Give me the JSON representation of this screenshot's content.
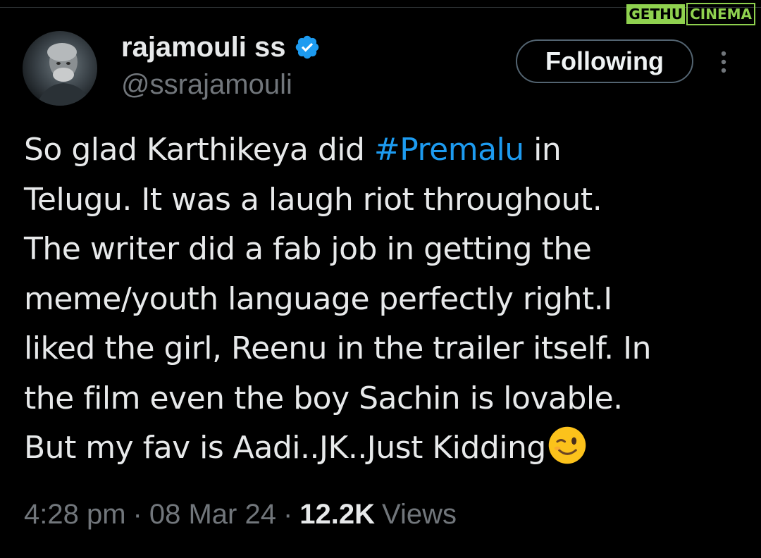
{
  "watermark": {
    "part_a": "GETHU",
    "part_b": "CINEMA"
  },
  "author": {
    "display_name": "rajamouli ss",
    "handle": "@ssrajamouli",
    "verified": true,
    "verified_color": "#1d9bf0"
  },
  "follow_button": {
    "label": "Following"
  },
  "tweet": {
    "lines": [
      {
        "before": "So glad Karthikeya did ",
        "hashtag": "#Premalu",
        "after": " in"
      },
      {
        "text": "Telugu. It was a laugh riot throughout."
      },
      {
        "text": "The writer did a fab job in getting the"
      },
      {
        "text": "meme/youth language perfectly right.I"
      },
      {
        "text": "liked the girl, Reenu in the trailer itself. In"
      },
      {
        "text": "the film even the boy Sachin is lovable."
      },
      {
        "text": "But my fav is Aadi..JK..Just Kidding",
        "emoji": "winking-face"
      }
    ],
    "hashtag_color": "#1d9bf0"
  },
  "meta": {
    "time": "4:28 pm",
    "separator": "·",
    "date": "08 Mar 24",
    "views_count": "12.2K",
    "views_label": "Views"
  },
  "icons": {
    "more": "more-vertical-icon",
    "verified": "verified-badge-icon",
    "emoji": "wink-emoji-icon"
  },
  "colors": {
    "background": "#000000",
    "text": "#e7e9ea",
    "muted": "#71767b",
    "accent": "#1d9bf0",
    "watermark": "#8fd14f"
  }
}
